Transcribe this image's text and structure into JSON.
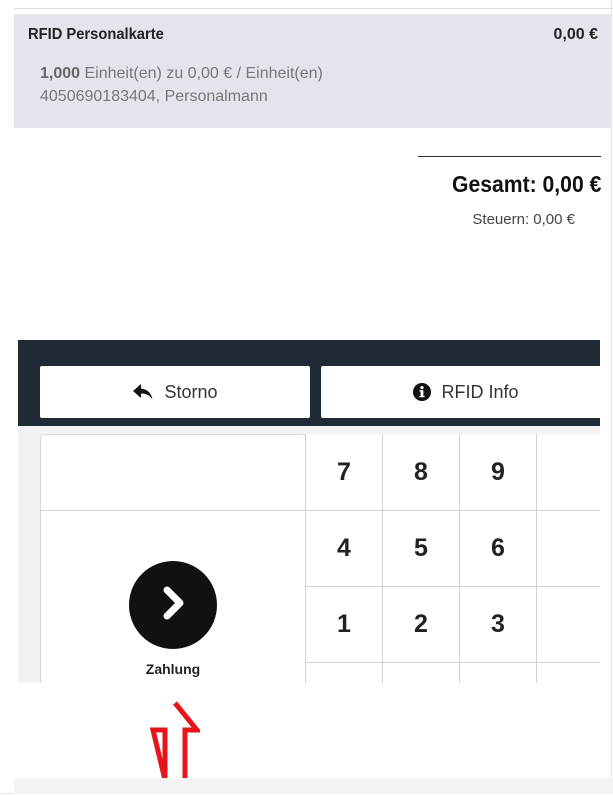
{
  "order_line": {
    "product_name": "RFID Personalkarte",
    "price": "0,00 €",
    "quantity": "1,000",
    "unit_info": "Einheit(en) zu 0,00 € / Einheit(en)",
    "details": "4050690183404, Personalmann"
  },
  "totals": {
    "total_label": "Gesamt: 0,00 €",
    "taxes_label": "Steuern: 0,00 €"
  },
  "control_buttons": {
    "storno_label": "Storno",
    "rfid_info_label": "RFID Info"
  },
  "payment": {
    "label": "Zahlung"
  },
  "keypad": {
    "keys": [
      "7",
      "8",
      "9",
      "",
      "4",
      "5",
      "6",
      "",
      "1",
      "2",
      "3",
      "",
      "",
      "",
      "",
      ""
    ]
  },
  "colors": {
    "order_line_bg": "#e3e5ed",
    "control_bar_bg": "#1f2a35",
    "payment_button": "#111111",
    "annotation_arrow": "#e8141b"
  },
  "icons": {
    "storno": "reply-arrow-icon",
    "rfid_info": "info-circle-icon",
    "payment": "chevron-right-icon",
    "annotation": "up-arrow-outline-icon"
  }
}
